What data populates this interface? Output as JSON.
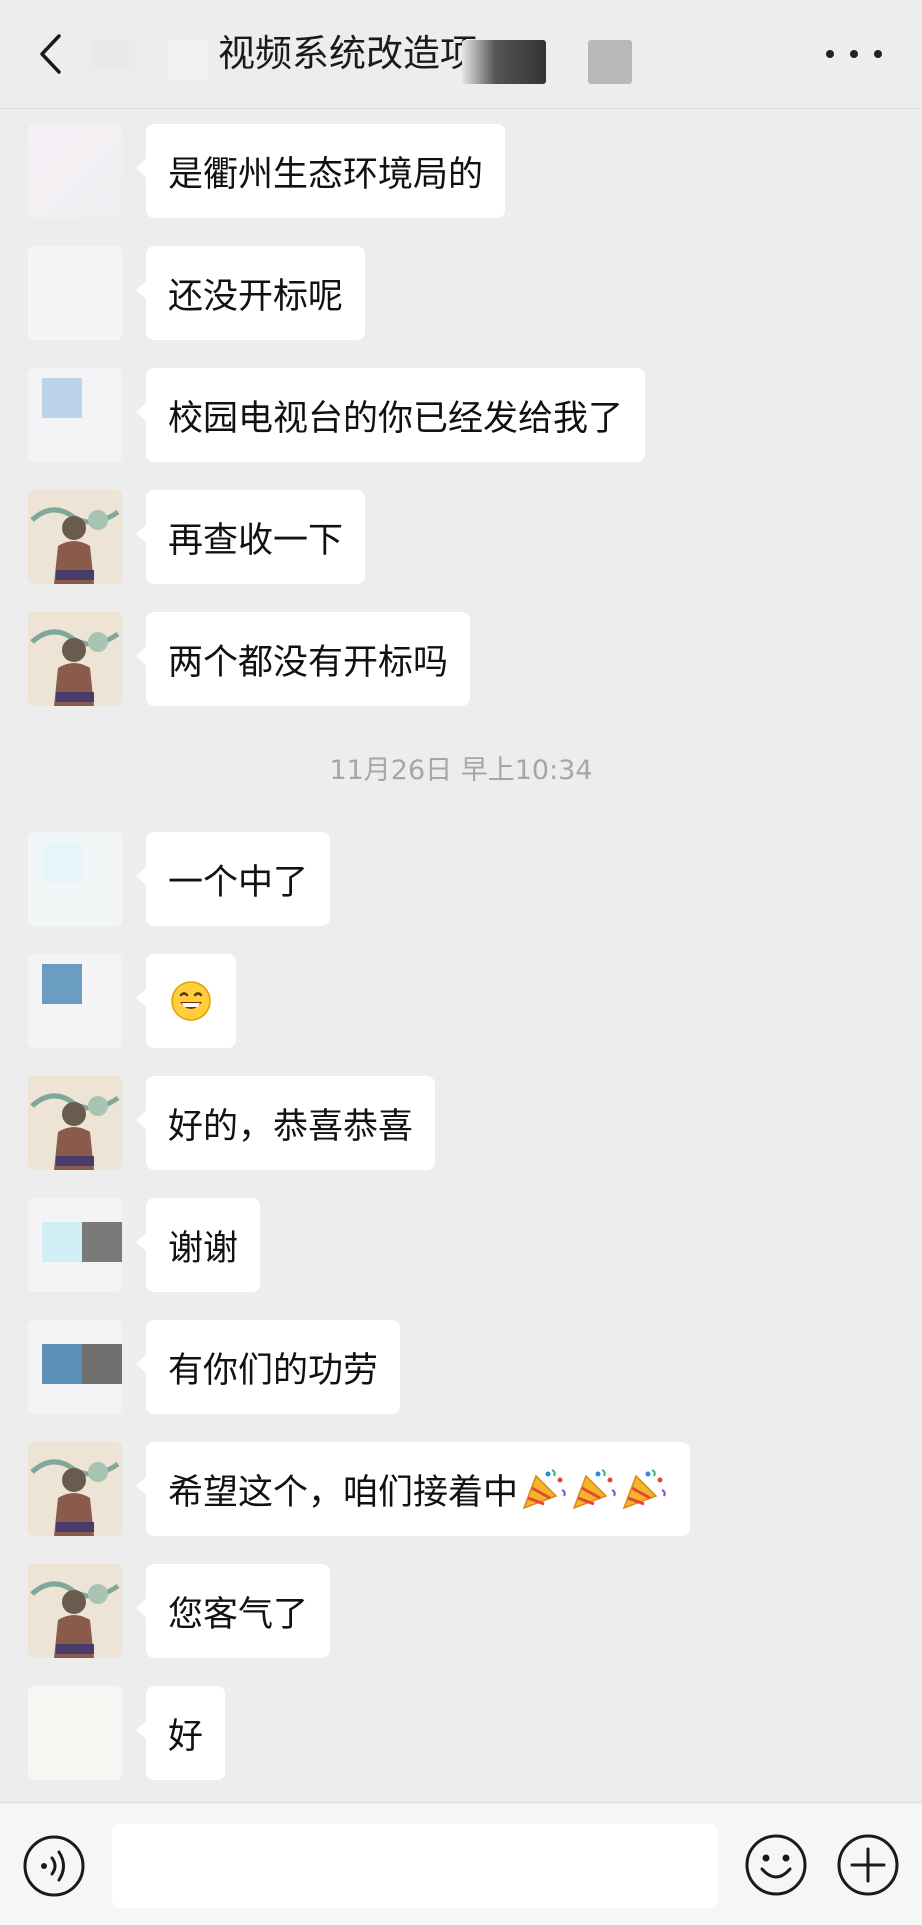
{
  "header": {
    "title": "视频系统改造项"
  },
  "messages": [
    {
      "text": "是衢州生态环境局的"
    },
    {
      "text": "还没开标呢"
    },
    {
      "text": "校园电视台的你已经发给我了"
    },
    {
      "text": "再查收一下"
    },
    {
      "text": "两个都没有开标吗"
    },
    {
      "text": "一个中了"
    },
    {
      "text": "",
      "emoji": "grinning-face-emoji"
    },
    {
      "text": "好的，恭喜恭喜"
    },
    {
      "text": "谢谢"
    },
    {
      "text": "有你们的功劳"
    },
    {
      "text": "希望这个，咱们接着中",
      "emoji": "party-popper-emoji"
    },
    {
      "text": "您客气了"
    },
    {
      "text": "好"
    }
  ],
  "timestamp": "11月26日 早上10:34",
  "input": {
    "placeholder": ""
  },
  "colors": {
    "background": "#ededed",
    "bubble": "#ffffff",
    "timestamp": "#a6a6a6"
  }
}
